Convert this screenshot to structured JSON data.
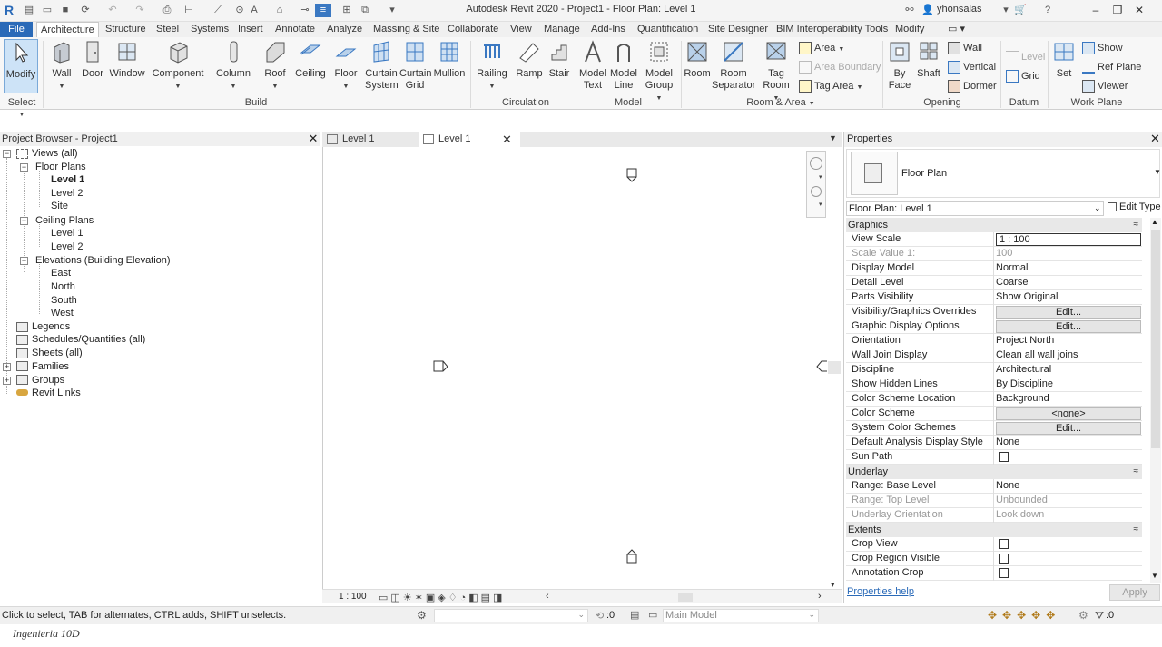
{
  "window": {
    "title": "Autodesk Revit 2020 - Project1 - Floor Plan: Level 1",
    "user": "yhonsalas"
  },
  "ribbon_tabs": [
    "File",
    "Architecture",
    "Structure",
    "Steel",
    "Systems",
    "Insert",
    "Annotate",
    "Analyze",
    "Massing & Site",
    "Collaborate",
    "View",
    "Manage",
    "Add-Ins",
    "Quantification",
    "Site Designer",
    "BIM Interoperability Tools",
    "Modify"
  ],
  "ribbon": {
    "select": {
      "modify": "Modify",
      "label": "Select"
    },
    "build": {
      "label": "Build",
      "wall": "Wall",
      "door": "Door",
      "window": "Window",
      "component": "Component",
      "column": "Column",
      "roof": "Roof",
      "ceiling": "Ceiling",
      "floor": "Floor",
      "curtain_system": [
        "Curtain",
        "System"
      ],
      "curtain_grid": [
        "Curtain",
        "Grid"
      ],
      "mullion": "Mullion"
    },
    "circulation": {
      "label": "Circulation",
      "railing": "Railing",
      "ramp": "Ramp",
      "stair": "Stair"
    },
    "model": {
      "label": "Model",
      "model_text": [
        "Model",
        "Text"
      ],
      "model_line": [
        "Model",
        "Line"
      ],
      "model_group": [
        "Model",
        "Group"
      ]
    },
    "room_area": {
      "label": "Room & Area",
      "room": "Room",
      "room_separator": [
        "Room",
        "Separator"
      ],
      "tag_room": [
        "Tag",
        "Room"
      ],
      "area": "Area",
      "area_boundary": "Area  Boundary",
      "tag_area": "Tag  Area"
    },
    "opening": {
      "label": "Opening",
      "by_face": [
        "By",
        "Face"
      ],
      "shaft": "Shaft",
      "wall": "Wall",
      "vertical": "Vertical",
      "dormer": "Dormer"
    },
    "datum": {
      "label": "Datum",
      "level": "Level",
      "grid": "Grid"
    },
    "work_plane": {
      "label": "Work Plane",
      "set": "Set",
      "show": "Show",
      "ref_plane": "Ref  Plane",
      "viewer": "Viewer"
    }
  },
  "project_browser": {
    "title": "Project Browser - Project1",
    "views_all": "Views (all)",
    "floor_plans": "Floor Plans",
    "floor_plan_items": [
      "Level 1",
      "Level 2",
      "Site"
    ],
    "ceiling_plans": "Ceiling Plans",
    "ceiling_plan_items": [
      "Level 1",
      "Level 2"
    ],
    "elevations": "Elevations (Building Elevation)",
    "elevation_items": [
      "East",
      "North",
      "South",
      "West"
    ],
    "legends": "Legends",
    "schedules": "Schedules/Quantities (all)",
    "sheets": "Sheets (all)",
    "families": "Families",
    "groups": "Groups",
    "revit_links": "Revit Links"
  },
  "view_tabs": [
    "Level 1",
    "Level 1"
  ],
  "view_scale_label": "1 : 100",
  "properties": {
    "title": "Properties",
    "type_name": "Floor Plan",
    "instance_selector": "Floor Plan: Level 1",
    "edit_type": "Edit Type",
    "help": "Properties help",
    "apply": "Apply",
    "groups": {
      "graphics": "Graphics",
      "underlay": "Underlay",
      "extents": "Extents"
    },
    "rows": {
      "view_scale": {
        "name": "View Scale",
        "value": "1 : 100"
      },
      "scale_value": {
        "name": "Scale Value    1:",
        "value": "100"
      },
      "display_model": {
        "name": "Display Model",
        "value": "Normal"
      },
      "detail_level": {
        "name": "Detail Level",
        "value": "Coarse"
      },
      "parts_visibility": {
        "name": "Parts Visibility",
        "value": "Show Original"
      },
      "vg_overrides": {
        "name": "Visibility/Graphics Overrides",
        "value": "Edit..."
      },
      "graphic_display": {
        "name": "Graphic Display Options",
        "value": "Edit..."
      },
      "orientation": {
        "name": "Orientation",
        "value": "Project North"
      },
      "wall_join": {
        "name": "Wall Join Display",
        "value": "Clean all wall joins"
      },
      "discipline": {
        "name": "Discipline",
        "value": "Architectural"
      },
      "hidden_lines": {
        "name": "Show Hidden Lines",
        "value": "By Discipline"
      },
      "color_scheme_location": {
        "name": "Color Scheme Location",
        "value": "Background"
      },
      "color_scheme": {
        "name": "Color Scheme",
        "value": "<none>"
      },
      "system_color": {
        "name": "System Color Schemes",
        "value": "Edit..."
      },
      "analysis_style": {
        "name": "Default Analysis Display Style",
        "value": "None"
      },
      "sun_path": {
        "name": "Sun Path",
        "checked": false
      },
      "base_level": {
        "name": "Range: Base Level",
        "value": "None"
      },
      "top_level": {
        "name": "Range: Top Level",
        "value": "Unbounded"
      },
      "underlay_orientation": {
        "name": "Underlay Orientation",
        "value": "Look down"
      },
      "crop_view": {
        "name": "Crop View",
        "checked": false
      },
      "crop_region": {
        "name": "Crop Region Visible",
        "checked": false
      },
      "annotation_crop": {
        "name": "Annotation Crop",
        "checked": false
      }
    }
  },
  "status_bar": {
    "hint": "Click to select, TAB for alternates, CTRL adds, SHIFT unselects.",
    "model_value": ":0",
    "model": "Main Model",
    "filter_count": ":0"
  },
  "footer_text": "Ingenieria 10D",
  "colors": {
    "file_tab": "#2a6ab8",
    "accent_icon": "#3a78c2",
    "ribbon_bg": "#f7f7f7"
  }
}
